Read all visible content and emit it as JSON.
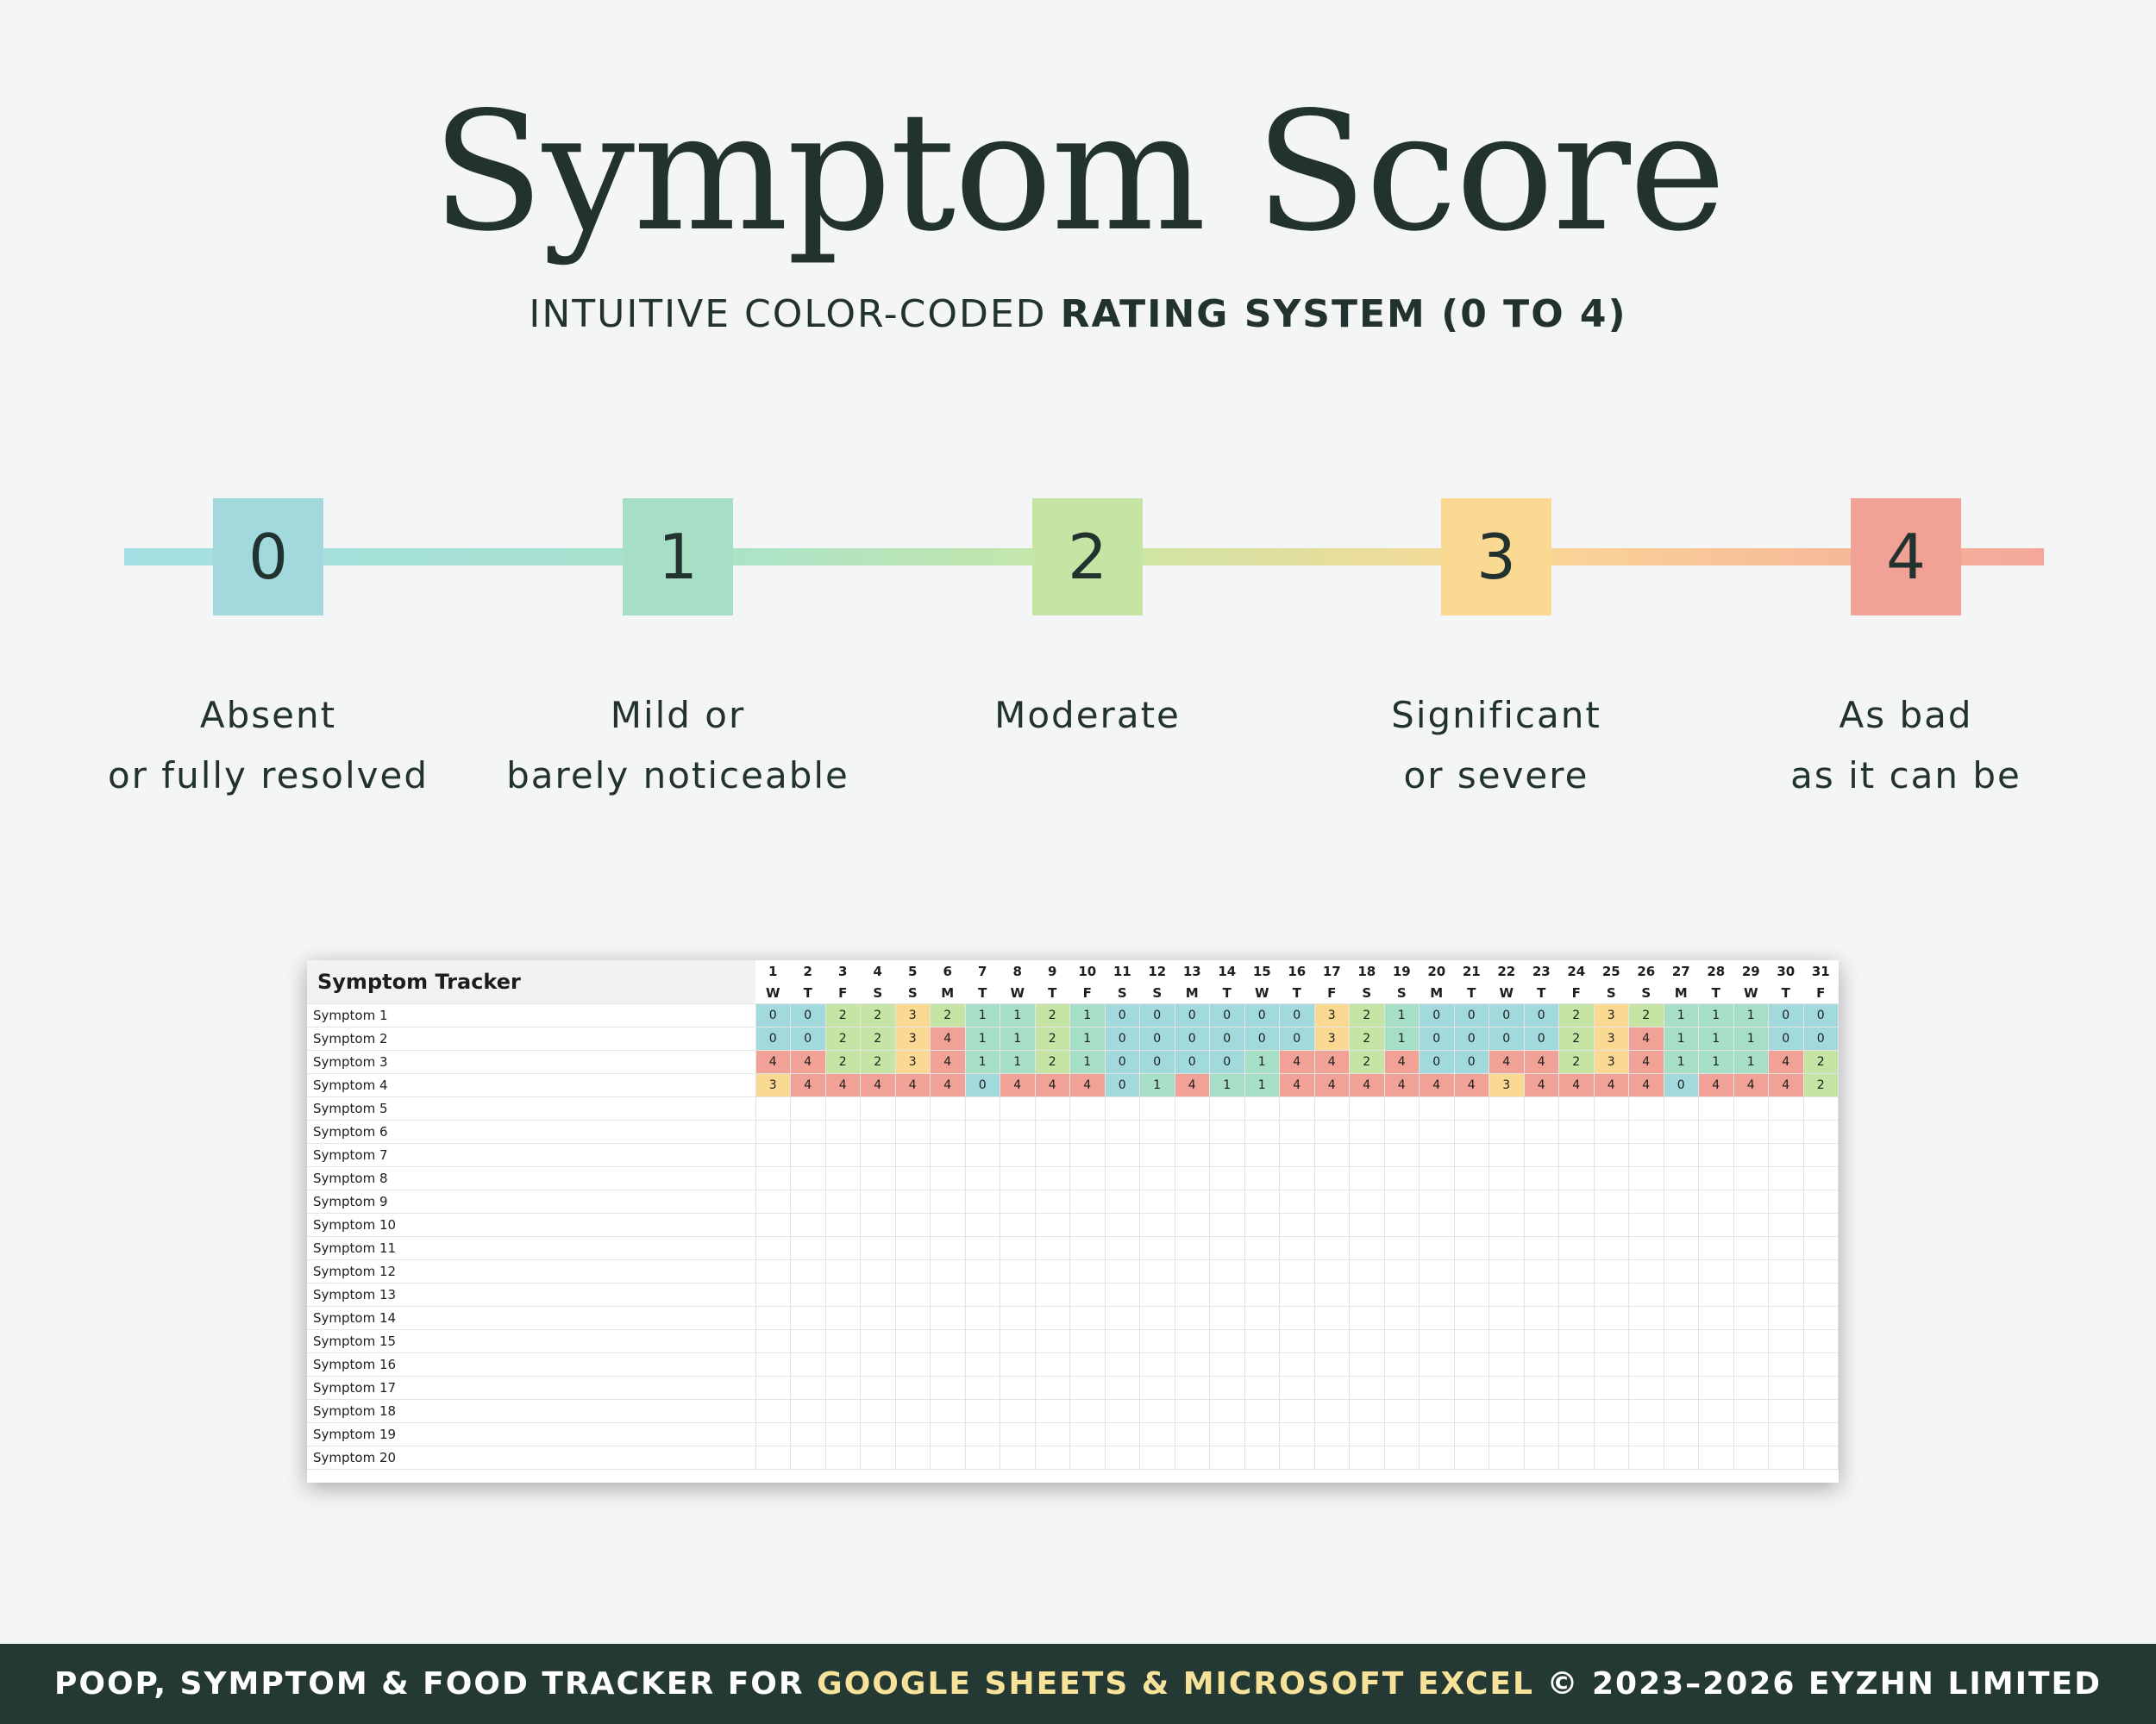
{
  "title": "Symptom Score",
  "subtitle": {
    "light": "INTUITIVE COLOR-CODED ",
    "bold": "RATING SYSTEM (0 TO 4)"
  },
  "scale": [
    {
      "value": "0",
      "color": "#a2d9dc",
      "line1": "Absent",
      "line2": "or fully resolved"
    },
    {
      "value": "1",
      "color": "#a6dfc5",
      "line1": "Mild or",
      "line2": "barely noticeable"
    },
    {
      "value": "2",
      "color": "#c6e5a4",
      "line1": "Moderate",
      "line2": ""
    },
    {
      "value": "3",
      "color": "#fad993",
      "line1": "Significant",
      "line2": "or severe"
    },
    {
      "value": "4",
      "color": "#f1a196",
      "line1": "As bad",
      "line2": "as it can be"
    }
  ],
  "tracker": {
    "title": "Symptom Tracker",
    "days": [
      "1",
      "2",
      "3",
      "4",
      "5",
      "6",
      "7",
      "8",
      "9",
      "10",
      "11",
      "12",
      "13",
      "14",
      "15",
      "16",
      "17",
      "18",
      "19",
      "20",
      "21",
      "22",
      "23",
      "24",
      "25",
      "26",
      "27",
      "28",
      "29",
      "30",
      "31"
    ],
    "weekdays": [
      "W",
      "T",
      "F",
      "S",
      "S",
      "M",
      "T",
      "W",
      "T",
      "F",
      "S",
      "S",
      "M",
      "T",
      "W",
      "T",
      "F",
      "S",
      "S",
      "M",
      "T",
      "W",
      "T",
      "F",
      "S",
      "S",
      "M",
      "T",
      "W",
      "T",
      "F"
    ],
    "rows": [
      {
        "label": "Symptom 1",
        "values": [
          0,
          0,
          2,
          2,
          3,
          2,
          1,
          1,
          2,
          1,
          0,
          0,
          0,
          0,
          0,
          0,
          3,
          2,
          1,
          0,
          0,
          0,
          0,
          2,
          3,
          2,
          1,
          1,
          1,
          0,
          0
        ]
      },
      {
        "label": "Symptom 2",
        "values": [
          0,
          0,
          2,
          2,
          3,
          4,
          1,
          1,
          2,
          1,
          0,
          0,
          0,
          0,
          0,
          0,
          3,
          2,
          1,
          0,
          0,
          0,
          0,
          2,
          3,
          4,
          1,
          1,
          1,
          0,
          0
        ]
      },
      {
        "label": "Symptom 3",
        "values": [
          4,
          4,
          2,
          2,
          3,
          4,
          1,
          1,
          2,
          1,
          0,
          0,
          0,
          0,
          1,
          4,
          4,
          2,
          4,
          0,
          0,
          4,
          4,
          2,
          3,
          4,
          1,
          1,
          1,
          4,
          2
        ]
      },
      {
        "label": "Symptom 4",
        "values": [
          3,
          4,
          4,
          4,
          4,
          4,
          0,
          4,
          4,
          4,
          0,
          1,
          4,
          1,
          1,
          4,
          4,
          4,
          4,
          4,
          4,
          3,
          4,
          4,
          4,
          4,
          0,
          4,
          4,
          4,
          2
        ]
      },
      {
        "label": "Symptom 5",
        "values": []
      },
      {
        "label": "Symptom 6",
        "values": []
      },
      {
        "label": "Symptom 7",
        "values": []
      },
      {
        "label": "Symptom 8",
        "values": []
      },
      {
        "label": "Symptom 9",
        "values": []
      },
      {
        "label": "Symptom 10",
        "values": []
      },
      {
        "label": "Symptom 11",
        "values": []
      },
      {
        "label": "Symptom 12",
        "values": []
      },
      {
        "label": "Symptom 13",
        "values": []
      },
      {
        "label": "Symptom 14",
        "values": []
      },
      {
        "label": "Symptom 15",
        "values": []
      },
      {
        "label": "Symptom 16",
        "values": []
      },
      {
        "label": "Symptom 17",
        "values": []
      },
      {
        "label": "Symptom 18",
        "values": []
      },
      {
        "label": "Symptom 19",
        "values": []
      },
      {
        "label": "Symptom 20",
        "values": []
      }
    ]
  },
  "footer": {
    "part1": "POOP, SYMPTOM & FOOD TRACKER FOR ",
    "highlight": "GOOGLE SHEETS & MICROSOFT EXCEL",
    "part2": " © 2023–2026 EYZHN LIMITED"
  }
}
